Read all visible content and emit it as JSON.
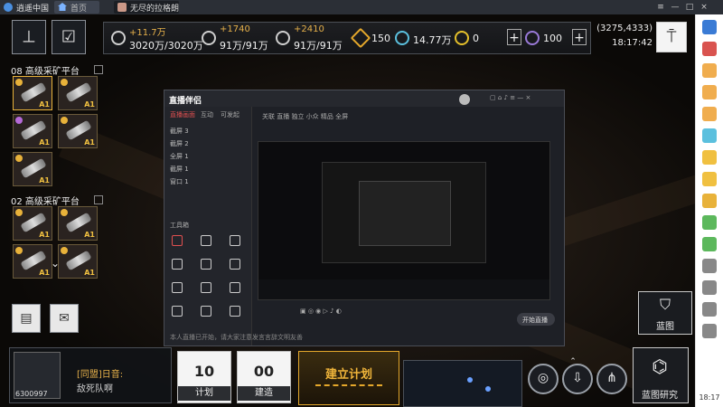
{
  "emulator": {
    "title": "逍遥中国",
    "home_tab_label": "首页",
    "game_tab_label": "无尽的拉格朗日",
    "controls": [
      "≡",
      "—",
      "□",
      "×"
    ],
    "sidebar_time": "18:17",
    "sidebar_icons": [
      "#3a7bd5",
      "#d9534f",
      "#f0ad4e",
      "#f0ad4e",
      "#f0ad4e",
      "#5bc0de",
      "#f0c040",
      "#f0c040",
      "#e8b23a",
      "#5cb85c",
      "#5cb85c",
      "#888888",
      "#888888",
      "#888888",
      "#888888"
    ]
  },
  "hud": {
    "resources": [
      {
        "delta": "+11.7万",
        "value": "3020万/3020万"
      },
      {
        "delta": "+1740",
        "value": "91万/91万"
      },
      {
        "delta": "+2410",
        "value": "91万/91万"
      },
      {
        "value": "150"
      },
      {
        "value": "14.77万"
      },
      {
        "value": "0"
      },
      {
        "value": "100"
      }
    ],
    "coords": "(3275,4333)",
    "time": "18:17:42",
    "panels": [
      {
        "title": "08 高级采矿平台"
      },
      {
        "title": "02 高级采矿平台"
      }
    ],
    "slot_level": "A1",
    "chat": {
      "tag": "[同盟]日音:",
      "message": "敌死队啊",
      "user_id": "6300997"
    },
    "actions": [
      {
        "value": "10",
        "label": "计划"
      },
      {
        "value": "00",
        "label": "建造"
      }
    ],
    "plan_button": "建立计划",
    "blueprint_label": "蓝图",
    "blueprint_research_label": "蓝图研究"
  },
  "stream": {
    "app_name": "直播伴侣",
    "tab_labels": [
      "直播画面",
      "互动",
      "可发起"
    ],
    "scenes": [
      "截屏 3",
      "截屏 2",
      "全屏 1",
      "截屏 1",
      "窗口 1"
    ],
    "toolbar_label": "工具箱",
    "status_text": "关联 直播 独立 小众 精品 全屏",
    "footer_text": "本人直播已开始，请大家注意发言言辞文明友善",
    "start_button": "开始直播"
  }
}
